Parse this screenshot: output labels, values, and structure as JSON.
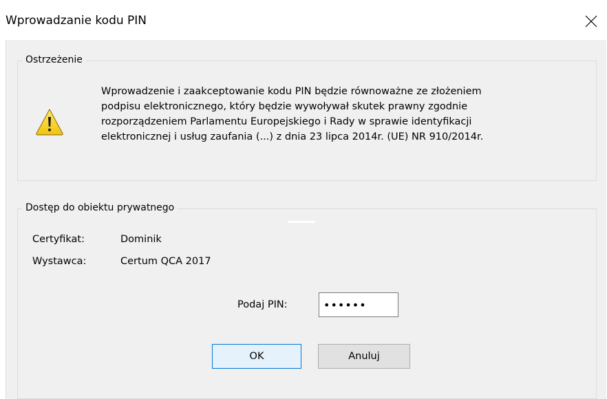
{
  "window": {
    "title": "Wprowadzanie kodu PIN",
    "close_icon": "close-icon"
  },
  "warning": {
    "group_title": "Ostrzeżenie",
    "icon": "warning-icon",
    "lines": [
      "Wprowadzenie i zaakceptowanie kodu PIN będzie równoważne ze złożeniem",
      "podpisu elektronicznego, który będzie wywoływał skutek prawny zgodnie",
      "rozporządzeniem Parlamentu Europejskiego i Rady w sprawie identyfikacji",
      "elektronicznej i usług zaufania (...) z dnia 23 lipca 2014r. (UE) NR 910/2014r."
    ]
  },
  "access": {
    "group_title": "Dostęp do obiektu prywatnego",
    "certificate_label": "Certyfikat:",
    "certificate_value": "Dominik",
    "issuer_label": "Wystawca:",
    "issuer_value": "Certum QCA 2017",
    "pin_label": "Podaj PIN:",
    "pin_value": "••••••"
  },
  "buttons": {
    "ok": "OK",
    "cancel": "Anuluj"
  },
  "colors": {
    "accent": "#0078d7",
    "background": "#f0f0f0",
    "warning_yellow": "#f7d21e"
  }
}
